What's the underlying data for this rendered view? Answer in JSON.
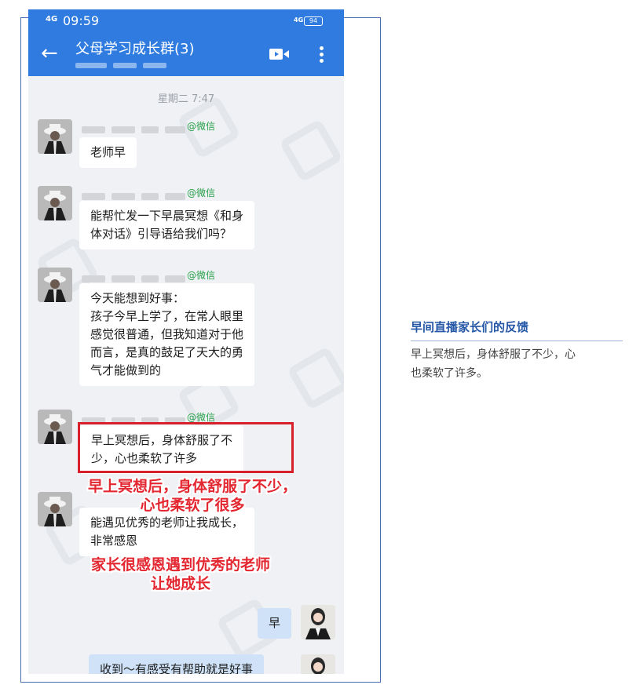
{
  "status_bar": {
    "signal": "4G",
    "time": "09:59",
    "network": "4G",
    "battery": "94"
  },
  "chat": {
    "title": "父母学习成长群(3)",
    "timestamp": "星期二 7:47",
    "source_tag": "@微信",
    "messages": [
      {
        "from": "other",
        "lines": [
          "老师早"
        ]
      },
      {
        "from": "other",
        "lines": [
          "能帮忙发一下早晨冥想《和身",
          "体对话》引导语给我们吗？"
        ]
      },
      {
        "from": "other",
        "lines": [
          "今天能想到好事：",
          "孩子今早上学了，在常人眼里",
          "感觉很普通，但我知道对于他",
          "而言，是真的鼓足了天大的勇",
          "气才能做到的"
        ]
      },
      {
        "from": "other",
        "lines": [
          "早上冥想后，身体舒服了不",
          "少，心也柔软了许多"
        ]
      },
      {
        "from": "other",
        "lines": [
          "能遇见优秀的老师让我成长，",
          "非常感恩"
        ]
      },
      {
        "from": "self",
        "lines": [
          "早"
        ]
      },
      {
        "from": "self",
        "lines": [
          "收到～有感受有帮助就是好事"
        ]
      }
    ]
  },
  "overlays": {
    "annotation_1": [
      "早上冥想后，身体舒服了不少，",
      "心也柔软了很多"
    ],
    "annotation_2": [
      "家长很感恩遇到优秀的老师",
      "让她成长"
    ]
  },
  "side_panel": {
    "title": "早间直播家长们的反馈",
    "body": [
      "早上冥想后，身体舒服了不少，心",
      "也柔软了许多。"
    ]
  },
  "colors": {
    "header": "#2f7be0",
    "highlight": "#d8202a",
    "overlay_text": "#e3262f",
    "side_title": "#2557a7",
    "wechat_tag": "#27a04a"
  },
  "icons": [
    "back-arrow-icon",
    "video-call-icon",
    "more-menu-icon"
  ]
}
